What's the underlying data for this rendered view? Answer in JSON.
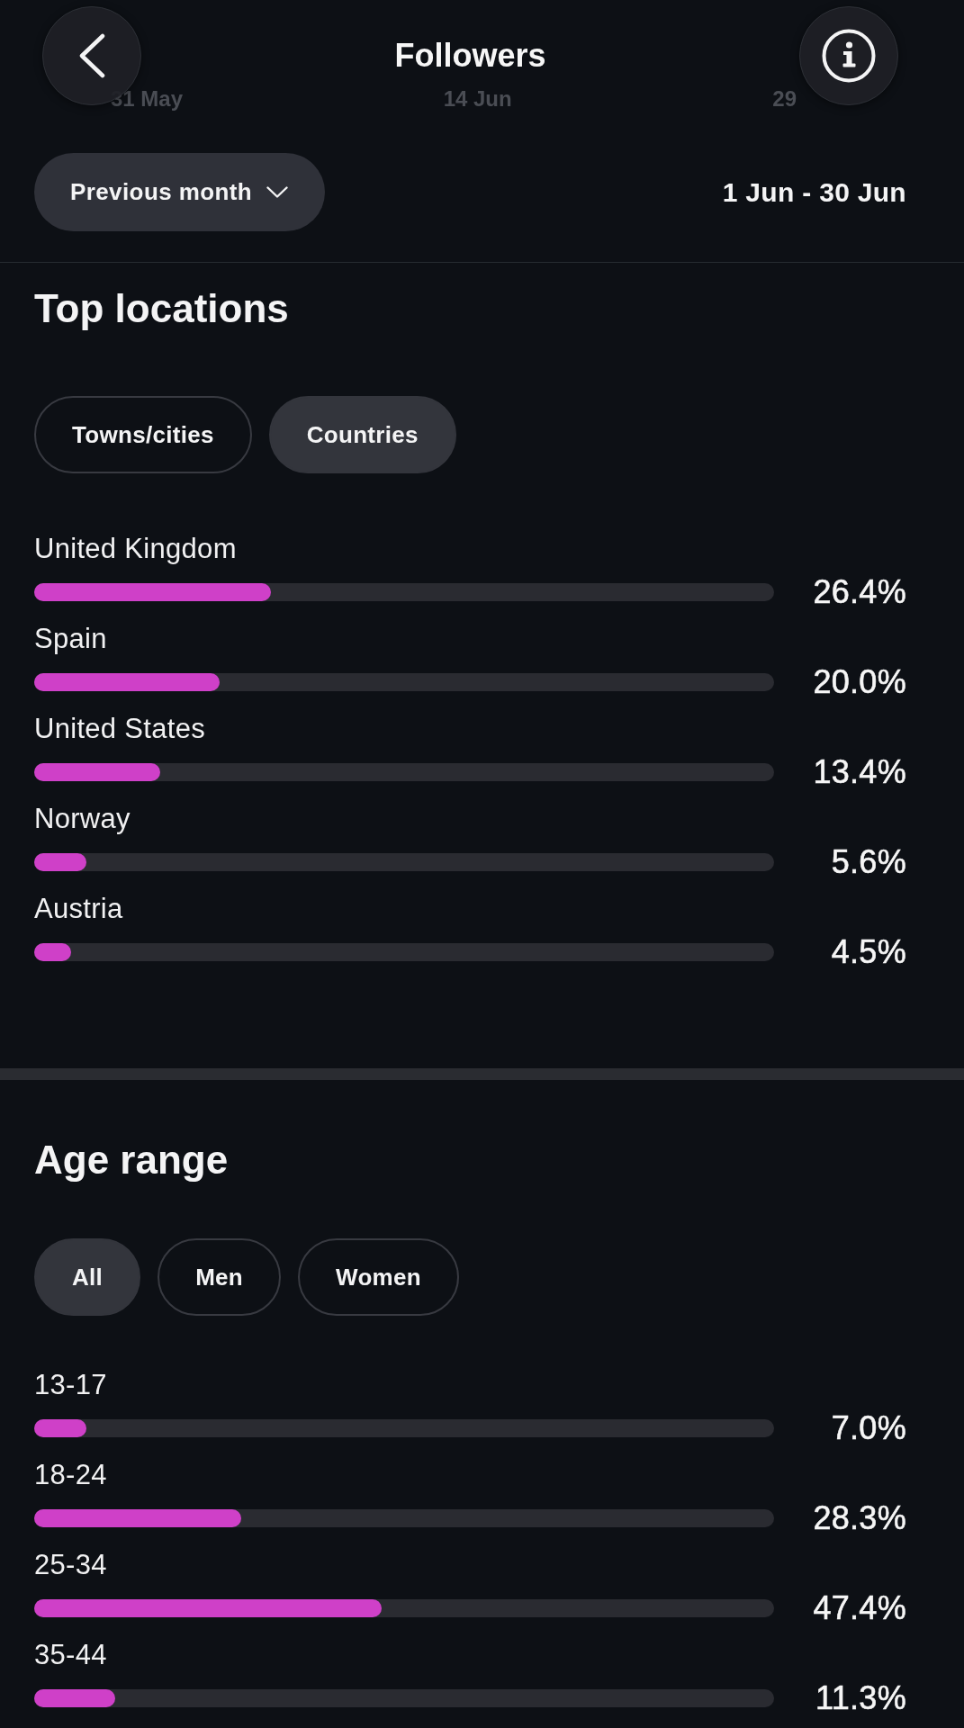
{
  "header": {
    "title": "Followers"
  },
  "background_chart": {
    "x_labels": [
      "31 May",
      "14 Jun",
      "29"
    ]
  },
  "period": {
    "dropdown": "Previous month",
    "range": "1 Jun - 30 Jun"
  },
  "top_locations": {
    "title": "Top locations",
    "tabs": [
      {
        "label": "Towns/cities",
        "selected": false
      },
      {
        "label": "Countries",
        "selected": true
      }
    ],
    "rows": [
      {
        "label": "United Kingdom",
        "level": 0.32,
        "value": "26.4%"
      },
      {
        "label": "Spain",
        "level": 0.25,
        "value": "20.0%"
      },
      {
        "label": "United States",
        "level": 0.17,
        "value": "13.4%"
      },
      {
        "label": "Norway",
        "level": 0.07,
        "value": "5.6%"
      },
      {
        "label": "Austria",
        "level": 0.05,
        "value": "4.5%"
      }
    ]
  },
  "age_range": {
    "title": "Age range",
    "tabs": [
      {
        "label": "All",
        "selected": true
      },
      {
        "label": "Men",
        "selected": false
      },
      {
        "label": "Women",
        "selected": false
      }
    ],
    "rows": [
      {
        "label": "13-17",
        "level": 0.07,
        "value": "7.0%"
      },
      {
        "label": "18-24",
        "level": 0.28,
        "value": "28.3%"
      },
      {
        "label": "25-34",
        "level": 0.47,
        "value": "47.4%"
      },
      {
        "label": "35-44",
        "level": 0.11,
        "value": "11.3%"
      }
    ]
  }
}
